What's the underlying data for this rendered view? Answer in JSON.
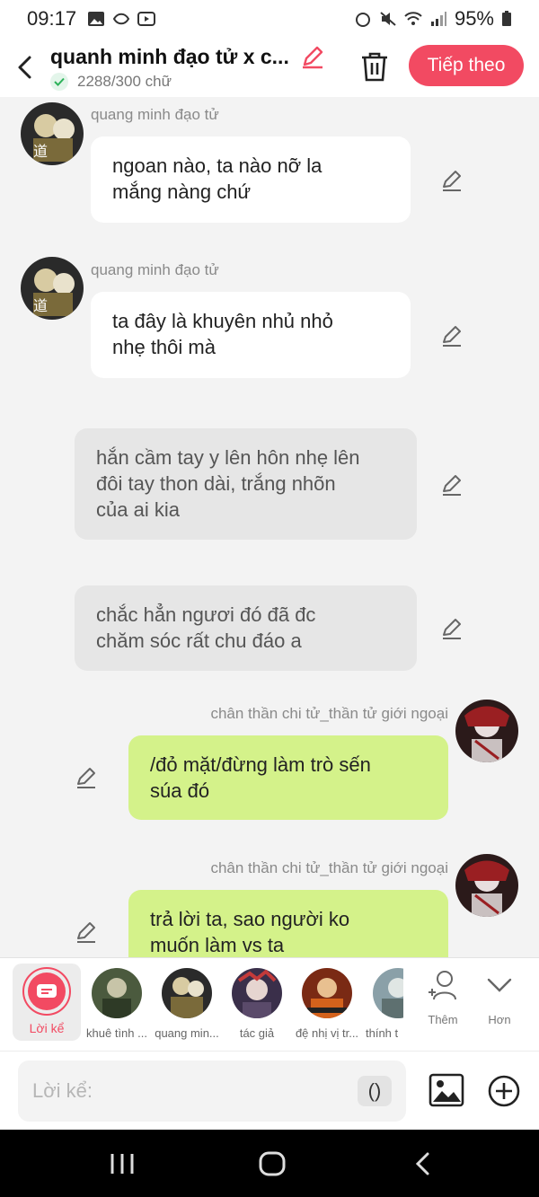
{
  "status": {
    "time": "09:17",
    "battery": "95%"
  },
  "header": {
    "title": "quanh minh đạo tử x c...",
    "word_count": "2288/300 chữ",
    "next_label": "Tiếp theo",
    "accent": "#f24a62"
  },
  "messages": [
    {
      "sender": "quang minh đạo tử",
      "text_lines": [
        "ngoan nào, ta nào nỡ la",
        "mắng nàng chứ"
      ],
      "style": "white"
    },
    {
      "sender": "quang minh đạo tử",
      "text_lines": [
        "ta đây là khuyên nhủ nhỏ",
        "nhẹ thôi mà"
      ],
      "style": "white"
    },
    {
      "text_lines": [
        "hắn cầm tay y lên hôn nhẹ lên",
        "đôi tay thon dài, trắng nhõn",
        "của ai kia"
      ],
      "style": "gray"
    },
    {
      "text_lines": [
        "chắc hẳn ngươi đó đã đc",
        "chăm sóc rất chu đáo a"
      ],
      "style": "gray"
    },
    {
      "sender": "chân thần chi tử_thần tử giới ngoại",
      "text_lines": [
        "/đỏ mặt/đừng làm trò sến",
        "súa đó"
      ],
      "style": "green"
    },
    {
      "sender": "chân thần chi tử_thần tử giới ngoại",
      "text_lines": [
        "trả lời ta, sao người ko",
        "muốn làm vs ta"
      ],
      "style": "green"
    }
  ],
  "characters": {
    "narrator": "Lời kể",
    "items": [
      "khuê tình ...",
      "quang min...",
      "tác giả",
      "đệ nhị vị tr...",
      "thính t"
    ],
    "add_label": "Thêm",
    "more_label": "Hơn"
  },
  "input": {
    "placeholder": "Lời kể:",
    "paren": "()"
  }
}
